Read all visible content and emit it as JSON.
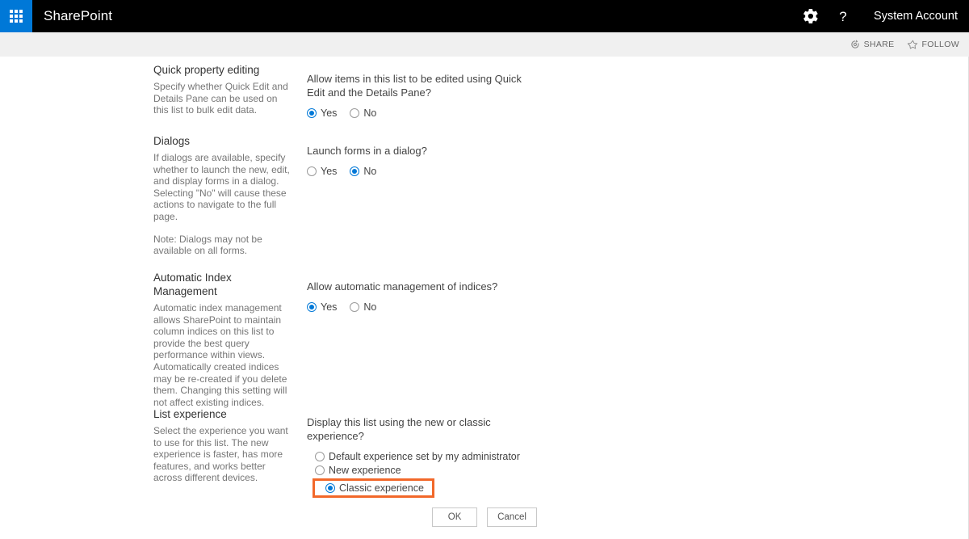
{
  "suite_bar": {
    "waffle_icon": "app-launcher-waffle-icon",
    "brand": "SharePoint",
    "settings_icon": "gear-icon",
    "help_icon": "question-mark-icon",
    "account": "System Account"
  },
  "command_band": {
    "share_icon": "share-icon",
    "share_label": "SHARE",
    "follow_icon": "star-icon",
    "follow_label": "FOLLOW"
  },
  "settings": {
    "quick_property_editing": {
      "title": "Quick property editing",
      "description": "Specify whether Quick Edit and Details Pane can be used on this list to bulk edit data.",
      "question": "Allow items in this list to be edited using Quick Edit and the Details Pane?",
      "options": [
        {
          "label": "Yes",
          "checked": true
        },
        {
          "label": "No",
          "checked": false
        }
      ]
    },
    "dialogs": {
      "title": "Dialogs",
      "description": "If dialogs are available, specify whether to launch the new, edit, and display forms in a dialog. Selecting \"No\" will cause these actions to navigate to the full page.",
      "note": "Note: Dialogs may not be available on all forms.",
      "question": "Launch forms in a dialog?",
      "options": [
        {
          "label": "Yes",
          "checked": false
        },
        {
          "label": "No",
          "checked": true
        }
      ]
    },
    "automatic_index_management": {
      "title": "Automatic Index Management",
      "description": "Automatic index management allows SharePoint to maintain column indices on this list to provide the best query performance within views. Automatically created indices may be re-created if you delete them. Changing this setting will not affect existing indices.",
      "question": "Allow automatic management of indices?",
      "options": [
        {
          "label": "Yes",
          "checked": true
        },
        {
          "label": "No",
          "checked": false
        }
      ]
    },
    "list_experience": {
      "title": "List experience",
      "description": "Select the experience you want to use for this list. The new experience is faster, has more features, and works better across different devices.",
      "question": "Display this list using the new or classic experience?",
      "options": [
        {
          "label": "Default experience set by my administrator",
          "checked": false
        },
        {
          "label": "New experience",
          "checked": false
        },
        {
          "label": "Classic experience",
          "checked": true
        }
      ],
      "highlighted_option": "Classic experience"
    }
  },
  "form_buttons": {
    "ok_label": "OK",
    "cancel_label": "Cancel"
  },
  "colors": {
    "suite_bar_bg": "#000000",
    "waffle_tile_bg": "#0078d7",
    "command_band_bg": "#f0f0f0",
    "radio_accent": "#0078d7",
    "highlight_border": "#f2682a",
    "heading_text": "#333333",
    "body_text": "#767676"
  }
}
